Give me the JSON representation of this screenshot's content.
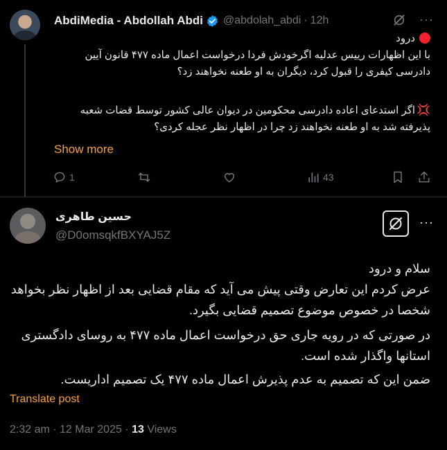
{
  "tweet1": {
    "author_name": "AbdiMedia - Abdollah Abdi",
    "handle": "@abdolah_abdi",
    "time": "12h",
    "lines": [
      "درود",
      "با این اظهارات رییس عدلیه اگرخودش فردا درخواست اعمال ماده ۴۷۷ قانون آیین",
      "دادرسی کیفری را قبول کرد، دیگران به او طعنه نخواهند زد؟",
      "",
      "اگر استدعای اعاده دادرسی محکومین در دیوان عالی کشور توسط قضات شعبه",
      "پذیرفته شد به او طعنه نخواهند زد چرا در اظهار نظر عجله کردی؟"
    ],
    "show_more": "Show more",
    "replies": "1",
    "views": "43"
  },
  "tweet2": {
    "author_name": "حسین طاهری",
    "handle": "@D0omsqkfBXYAJ5Z",
    "lines": [
      "سلام و درود",
      "عرض کردم این تعارض وقتی پیش می آید که مقام قضایی  بعد از اظهار نظر بخواهد",
      "شخصا در خصوص موضوع تصمیم قضایی بگیرد.",
      "در صورتی که در رویه جاری حق درخواست اعمال ماده ۴۷۷ به روسای دادگستری",
      "استانها واگذار شده است.",
      "ضمن این که تصمیم به عدم پذیرش اعمال ماده ۴۷۷ یک  تصمیم اداریست."
    ],
    "translate": "Translate post",
    "timestamp": "2:32 am · 12 Mar 2025 · ",
    "views_count": "13",
    "views_label": " Views"
  },
  "colors": {
    "background": "#000000",
    "text": "#e7e9ea",
    "muted": "#71767b",
    "accent_link": "#f4a340",
    "verified": "#1d9bf0",
    "red": "#f4212e"
  },
  "icons": [
    "verified-badge-icon",
    "grok-icon",
    "more-icon",
    "reply-icon",
    "retweet-icon",
    "like-icon",
    "analytics-icon",
    "bookmark-icon",
    "share-icon"
  ]
}
